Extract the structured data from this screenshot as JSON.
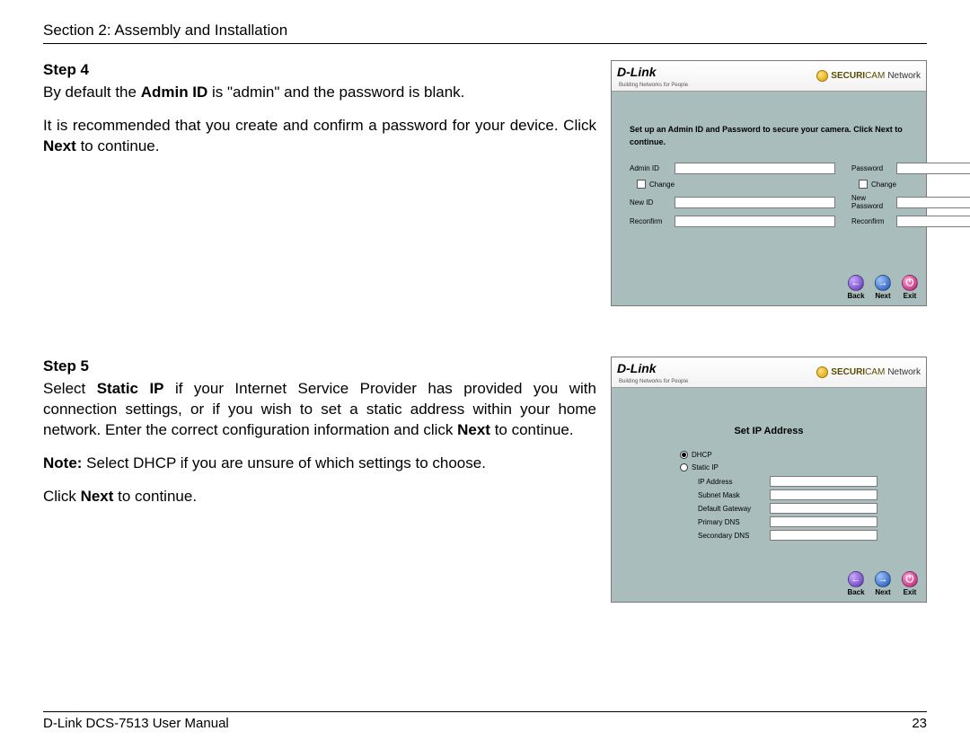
{
  "header": {
    "section": "Section 2: Assembly and Installation"
  },
  "footer": {
    "manual": "D-Link DCS-7513 User Manual",
    "page": "23"
  },
  "brand": {
    "name": "D-Link",
    "tag": "Building Networks for People"
  },
  "securicam": {
    "prefix": "SECURI",
    "suffix": "CAM",
    "tail": "Network"
  },
  "nav": {
    "back": "Back",
    "next": "Next",
    "exit": "Exit",
    "arrow_left": "←",
    "arrow_right": "→",
    "exit_glyph": "⏻"
  },
  "step4": {
    "title": "Step 4",
    "p1a": "By default the ",
    "p1b": "Admin ID",
    "p1c": " is \"admin\" and the password is blank.",
    "p2a": "It is recommended that you create and confirm a password for your device. Click ",
    "p2b": "Next",
    "p2c": " to continue.",
    "lead": "Set up an Admin ID and Password to secure your camera. Click Next to continue.",
    "labels": {
      "adminid": "Admin ID",
      "password": "Password",
      "change": "Change",
      "newid": "New ID",
      "newpassword": "New Password",
      "reconfirm1": "Reconfirm",
      "reconfirm2": "Reconfirm"
    }
  },
  "step5": {
    "title": "Step 5",
    "p1a": "Select ",
    "p1b": "Static IP",
    "p1c": " if your Internet Service Provider has provided you with connection settings, or if you wish to set a static address within your home network. Enter the correct configuration information and click ",
    "p1d": "Next",
    "p1e": " to continue.",
    "p2a": "Note:",
    "p2b": " Select DHCP if you are unsure of which settings to choose.",
    "p3a": "Click ",
    "p3b": "Next",
    "p3c": " to continue.",
    "wiz_title": "Set IP Address",
    "labels": {
      "dhcp": "DHCP",
      "staticip": "Static IP",
      "ip": "IP Address",
      "mask": "Subnet Mask",
      "gw": "Default Gateway",
      "dns1": "Primary DNS",
      "dns2": "Secondary DNS"
    }
  }
}
